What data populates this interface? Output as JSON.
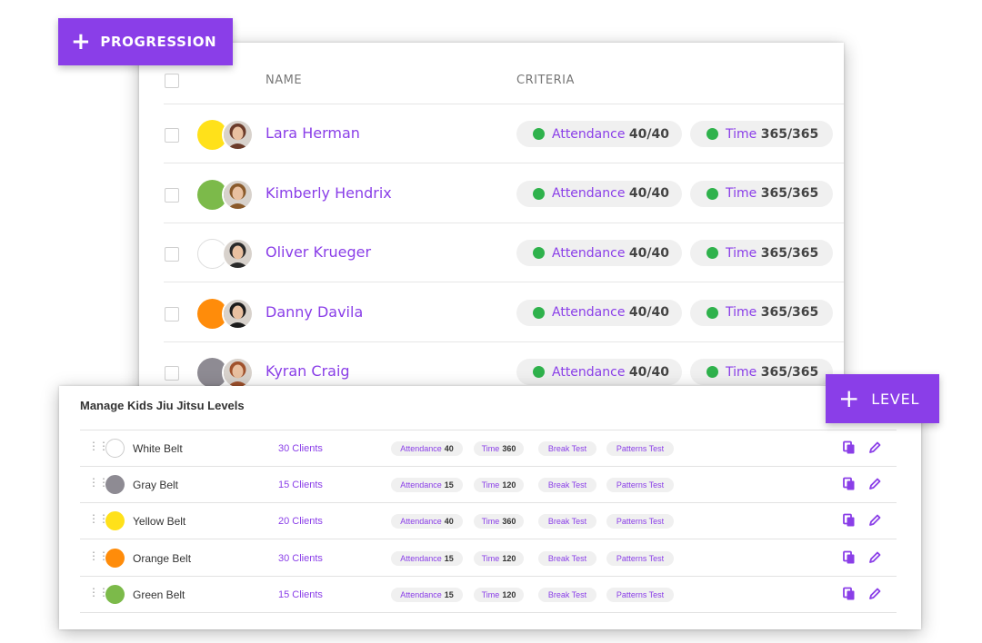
{
  "progression": {
    "add_button_label": "PROGRESSION",
    "columns": {
      "name": "NAME",
      "criteria": "CRITERIA"
    },
    "students": [
      {
        "name": "Lara Herman",
        "belt_color": "#ffe11a",
        "attendance_label": "Attendance",
        "attendance_value": "40/40",
        "time_label": "Time",
        "time_value": "365/365"
      },
      {
        "name": "Kimberly Hendrix",
        "belt_color": "#7cba4a",
        "attendance_label": "Attendance",
        "attendance_value": "40/40",
        "time_label": "Time",
        "time_value": "365/365"
      },
      {
        "name": "Oliver Krueger",
        "belt_color": "#ffffff",
        "attendance_label": "Attendance",
        "attendance_value": "40/40",
        "time_label": "Time",
        "time_value": "365/365"
      },
      {
        "name": "Danny Davila",
        "belt_color": "#ff8c0a",
        "attendance_label": "Attendance",
        "attendance_value": "40/40",
        "time_label": "Time",
        "time_value": "365/365"
      },
      {
        "name": "Kyran Craig",
        "belt_color": "#8e8b93",
        "attendance_label": "Attendance",
        "attendance_value": "40/40",
        "time_label": "Time",
        "time_value": "365/365"
      }
    ]
  },
  "levels": {
    "title": "Manage Kids Jiu Jitsu Levels",
    "add_button_label": "LEVEL",
    "items": [
      {
        "name": "White Belt",
        "color": "#ffffff",
        "clients": "30 Clients",
        "attendance_label": "Attendance",
        "attendance": "40",
        "time_label": "Time",
        "time": "360",
        "break_test": "Break Test",
        "patterns_test": "Patterns Test"
      },
      {
        "name": "Gray Belt",
        "color": "#8e8b93",
        "clients": "15 Clients",
        "attendance_label": "Attendance",
        "attendance": "15",
        "time_label": "Time",
        "time": "120",
        "break_test": "Break Test",
        "patterns_test": "Patterns Test"
      },
      {
        "name": "Yellow Belt",
        "color": "#ffe11a",
        "clients": "20 Clients",
        "attendance_label": "Attendance",
        "attendance": "40",
        "time_label": "Time",
        "time": "360",
        "break_test": "Break Test",
        "patterns_test": "Patterns Test"
      },
      {
        "name": "Orange Belt",
        "color": "#ff8c0a",
        "clients": "30 Clients",
        "attendance_label": "Attendance",
        "attendance": "15",
        "time_label": "Time",
        "time": "120",
        "break_test": "Break Test",
        "patterns_test": "Patterns Test"
      },
      {
        "name": "Green Belt",
        "color": "#7cba4a",
        "clients": "15 Clients",
        "attendance_label": "Attendance",
        "attendance": "15",
        "time_label": "Time",
        "time": "120",
        "break_test": "Break Test",
        "patterns_test": "Patterns Test"
      }
    ]
  },
  "colors": {
    "accent": "#8a3ee8",
    "criteria_met": "#2fb24c"
  },
  "icons": {
    "add": "plus-icon",
    "drag": "drag-handle-icon",
    "copy": "copy-icon",
    "edit": "pencil-icon",
    "avatar": "avatar-icon"
  }
}
